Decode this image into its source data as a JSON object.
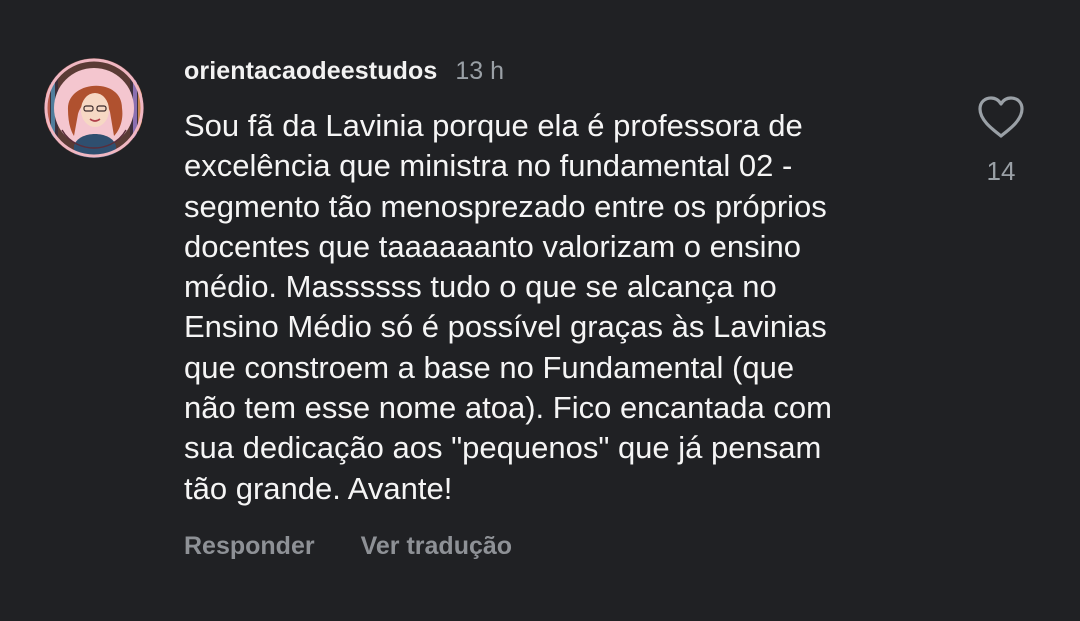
{
  "comment": {
    "username": "orientacaodeestudos",
    "timestamp": "13 h",
    "text": "Sou fã da Lavinia porque ela é professora de\nexcelência que ministra no fundamental 02 -\nsegmento tão menosprezado entre os próprios\ndocentes que taaaaaanto valorizam o ensino\nmédio.  Massssss tudo o que se alcança no\nEnsino Médio só é possível graças às Lavinias\nque constroem a base no Fundamental (que\nnão tem esse nome atoa). Fico encantada com\nsua dedicação aos \"pequenos\" que já pensam\ntão grande. Avante!",
    "like_count": "14",
    "like_icon": "heart-outline-icon"
  },
  "actions": {
    "reply_label": "Responder",
    "translate_label": "Ver tradução"
  },
  "colors": {
    "background": "#202124",
    "text": "#f5f5f5",
    "secondary_text": "#9aa0a6",
    "action_text": "#8e9196"
  }
}
